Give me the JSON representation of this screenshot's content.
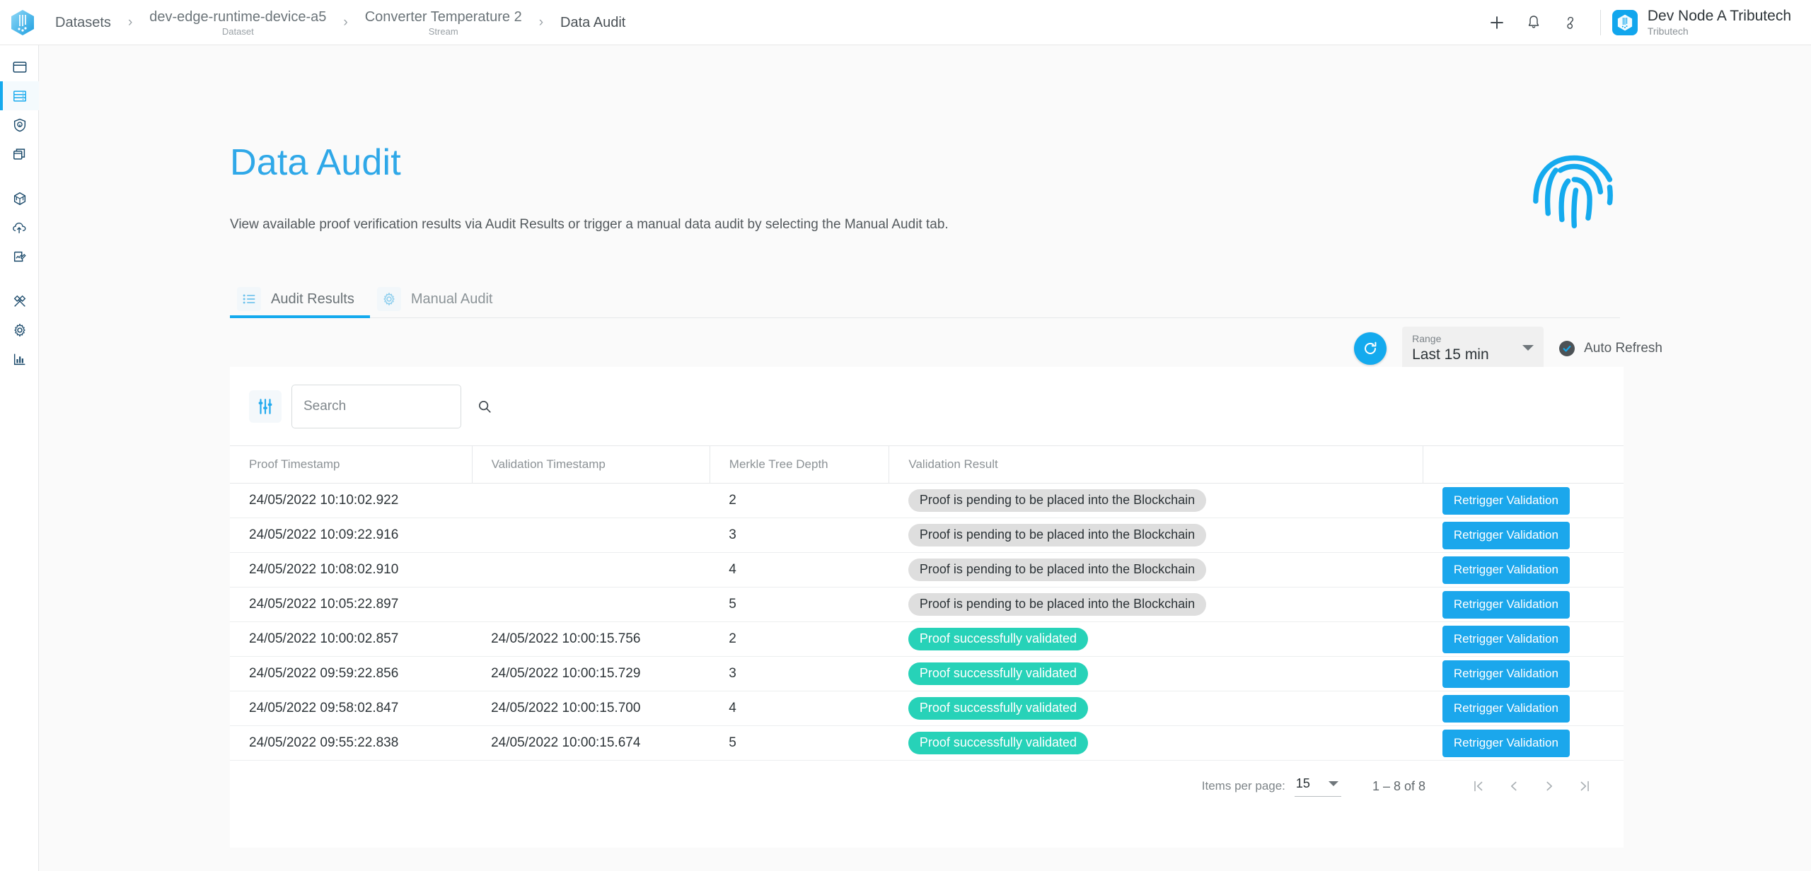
{
  "topbar": {
    "breadcrumb": [
      {
        "label": "Datasets",
        "sub": ""
      },
      {
        "label": "dev-edge-runtime-device-a5",
        "sub": "Dataset"
      },
      {
        "label": "Converter Temperature 2",
        "sub": "Stream"
      },
      {
        "label": "Data Audit",
        "sub": ""
      }
    ],
    "separator": "›",
    "icons": [
      "plus-icon",
      "bell-icon",
      "help-icon"
    ],
    "user": {
      "name": "Dev Node A Tributech",
      "org": "Tributech"
    }
  },
  "sidebar": {
    "items": [
      {
        "name": "dashboard-icon",
        "active": false
      },
      {
        "name": "datasets-icon",
        "active": true
      },
      {
        "name": "security-shield-icon",
        "active": false
      },
      {
        "name": "layers-icon",
        "active": false
      },
      {
        "name": "network-hex-icon",
        "active": false
      },
      {
        "name": "upload-icon",
        "active": false
      },
      {
        "name": "edit-document-icon",
        "active": false
      },
      {
        "name": "tools-icon",
        "active": false
      },
      {
        "name": "settings-gear-icon",
        "active": false
      },
      {
        "name": "analytics-chart-icon",
        "active": false
      }
    ]
  },
  "page": {
    "title": "Data Audit",
    "description": "View available proof verification results via Audit Results or trigger a manual data audit by selecting the Manual Audit tab.",
    "hero_icon": "fingerprint-icon"
  },
  "tabs": [
    {
      "label": "Audit Results",
      "icon": "list-icon",
      "active": true
    },
    {
      "label": "Manual Audit",
      "icon": "gear-icon",
      "active": false
    }
  ],
  "controls": {
    "refresh_icon": "refresh-icon",
    "range_label": "Range",
    "range_value": "Last 15 min",
    "auto_refresh_label": "Auto Refresh",
    "auto_refresh_checked": true
  },
  "toolbar": {
    "filter_icon": "filter-sliders-icon",
    "search_placeholder": "Search",
    "search_value": "",
    "search_icon": "search-icon"
  },
  "table": {
    "columns": [
      "Proof Timestamp",
      "Validation Timestamp",
      "Merkle Tree Depth",
      "Validation Result",
      ""
    ],
    "action_label": "Retrigger Validation",
    "rows": [
      {
        "proof_timestamp": "24/05/2022 10:10:02.922",
        "validation_timestamp": "",
        "merkle_tree_depth": "2",
        "validation_result": "Proof is pending to be placed into the Blockchain",
        "status": "pending"
      },
      {
        "proof_timestamp": "24/05/2022 10:09:22.916",
        "validation_timestamp": "",
        "merkle_tree_depth": "3",
        "validation_result": "Proof is pending to be placed into the Blockchain",
        "status": "pending"
      },
      {
        "proof_timestamp": "24/05/2022 10:08:02.910",
        "validation_timestamp": "",
        "merkle_tree_depth": "4",
        "validation_result": "Proof is pending to be placed into the Blockchain",
        "status": "pending"
      },
      {
        "proof_timestamp": "24/05/2022 10:05:22.897",
        "validation_timestamp": "",
        "merkle_tree_depth": "5",
        "validation_result": "Proof is pending to be placed into the Blockchain",
        "status": "pending"
      },
      {
        "proof_timestamp": "24/05/2022 10:00:02.857",
        "validation_timestamp": "24/05/2022 10:00:15.756",
        "merkle_tree_depth": "2",
        "validation_result": "Proof successfully validated",
        "status": "success"
      },
      {
        "proof_timestamp": "24/05/2022 09:59:22.856",
        "validation_timestamp": "24/05/2022 10:00:15.729",
        "merkle_tree_depth": "3",
        "validation_result": "Proof successfully validated",
        "status": "success"
      },
      {
        "proof_timestamp": "24/05/2022 09:58:02.847",
        "validation_timestamp": "24/05/2022 10:00:15.700",
        "merkle_tree_depth": "4",
        "validation_result": "Proof successfully validated",
        "status": "success"
      },
      {
        "proof_timestamp": "24/05/2022 09:55:22.838",
        "validation_timestamp": "24/05/2022 10:00:15.674",
        "merkle_tree_depth": "5",
        "validation_result": "Proof successfully validated",
        "status": "success"
      }
    ]
  },
  "paginator": {
    "items_per_page_label": "Items per page:",
    "items_per_page_value": "15",
    "range_text": "1 – 8 of 8",
    "first_icon": "first-page-icon",
    "prev_icon": "previous-page-icon",
    "next_icon": "next-page-icon",
    "last_icon": "last-page-icon"
  },
  "colors": {
    "accent": "#14AAEE",
    "title": "#2FA8E8",
    "success": "#27D2B8",
    "pending": "#DEDEDE",
    "page_bg": "#FAFAFA"
  }
}
